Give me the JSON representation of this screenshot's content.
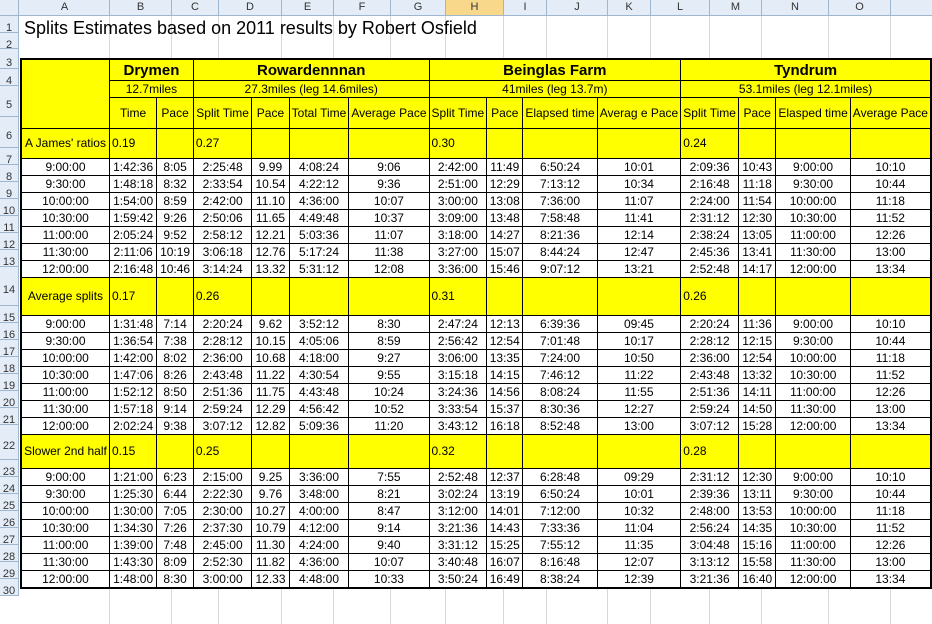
{
  "columns": [
    "A",
    "B",
    "C",
    "D",
    "E",
    "F",
    "G",
    "H",
    "I",
    "J",
    "K",
    "L",
    "M",
    "N",
    "O"
  ],
  "selected_column": "H",
  "rows": [
    "1",
    "2",
    "3",
    "4",
    "5",
    "6",
    "7",
    "8",
    "9",
    "10",
    "11",
    "12",
    "13",
    "14",
    "15",
    "16",
    "17",
    "18",
    "19",
    "20",
    "21",
    "22",
    "23",
    "24",
    "25",
    "26",
    "27",
    "28",
    "29",
    "30"
  ],
  "title": "Splits Estimates based on 2011 results by Robert Osfield",
  "sections": {
    "drymen": "Drymen",
    "rowardennan": "Rowardennnan",
    "beinglas": "Beinglas Farm",
    "tyndrum": "Tyndrum"
  },
  "distances": {
    "drymen": "12.7miles",
    "rowardennan": "27.3miles  (leg 14.6miles)",
    "beinglas": "41miles (leg 13.7m)",
    "tyndrum": "53.1miles (leg 12.1miles)"
  },
  "subheaders": [
    "Time",
    "Pace",
    "Split Time",
    "Pace",
    "Total Time",
    "Average Pace",
    "Split Time",
    "Pace",
    "Elapsed time",
    "Averag e Pace",
    "Split Time",
    "Pace",
    "Elasped time",
    "Average Pace"
  ],
  "blocks": [
    {
      "label": "A James' ratios",
      "ratios": {
        "drymen": "0.19",
        "rowardennan": "0.27",
        "beinglas": "0.30",
        "tyndrum": "0.24"
      },
      "rows": [
        [
          "9:00:00",
          "1:42:36",
          "8:05",
          "2:25:48",
          "9.99",
          "4:08:24",
          "9:06",
          "2:42:00",
          "11:49",
          "6:50:24",
          "10:01",
          "2:09:36",
          "10:43",
          "9:00:00",
          "10:10"
        ],
        [
          "9:30:00",
          "1:48:18",
          "8:32",
          "2:33:54",
          "10.54",
          "4:22:12",
          "9:36",
          "2:51:00",
          "12:29",
          "7:13:12",
          "10:34",
          "2:16:48",
          "11:18",
          "9:30:00",
          "10:44"
        ],
        [
          "10:00:00",
          "1:54:00",
          "8:59",
          "2:42:00",
          "11.10",
          "4:36:00",
          "10:07",
          "3:00:00",
          "13:08",
          "7:36:00",
          "11:07",
          "2:24:00",
          "11:54",
          "10:00:00",
          "11:18"
        ],
        [
          "10:30:00",
          "1:59:42",
          "9:26",
          "2:50:06",
          "11.65",
          "4:49:48",
          "10:37",
          "3:09:00",
          "13:48",
          "7:58:48",
          "11:41",
          "2:31:12",
          "12:30",
          "10:30:00",
          "11:52"
        ],
        [
          "11:00:00",
          "2:05:24",
          "9:52",
          "2:58:12",
          "12.21",
          "5:03:36",
          "11:07",
          "3:18:00",
          "14:27",
          "8:21:36",
          "12:14",
          "2:38:24",
          "13:05",
          "11:00:00",
          "12:26"
        ],
        [
          "11:30:00",
          "2:11:06",
          "10:19",
          "3:06:18",
          "12.76",
          "5:17:24",
          "11:38",
          "3:27:00",
          "15:07",
          "8:44:24",
          "12:47",
          "2:45:36",
          "13:41",
          "11:30:00",
          "13:00"
        ],
        [
          "12:00:00",
          "2:16:48",
          "10:46",
          "3:14:24",
          "13.32",
          "5:31:12",
          "12:08",
          "3:36:00",
          "15:46",
          "9:07:12",
          "13:21",
          "2:52:48",
          "14:17",
          "12:00:00",
          "13:34"
        ]
      ]
    },
    {
      "label": "Average splits",
      "ratios": {
        "drymen": "0.17",
        "rowardennan": "0.26",
        "beinglas": "0.31",
        "tyndrum": "0.26"
      },
      "rows": [
        [
          "9:00:00",
          "1:31:48",
          "7:14",
          "2:20:24",
          "9.62",
          "3:52:12",
          "8:30",
          "2:47:24",
          "12:13",
          "6:39:36",
          "09:45",
          "2:20:24",
          "11:36",
          "9:00:00",
          "10:10"
        ],
        [
          "9:30:00",
          "1:36:54",
          "7:38",
          "2:28:12",
          "10.15",
          "4:05:06",
          "8:59",
          "2:56:42",
          "12:54",
          "7:01:48",
          "10:17",
          "2:28:12",
          "12:15",
          "9:30:00",
          "10:44"
        ],
        [
          "10:00:00",
          "1:42:00",
          "8:02",
          "2:36:00",
          "10.68",
          "4:18:00",
          "9:27",
          "3:06:00",
          "13:35",
          "7:24:00",
          "10:50",
          "2:36:00",
          "12:54",
          "10:00:00",
          "11:18"
        ],
        [
          "10:30:00",
          "1:47:06",
          "8:26",
          "2:43:48",
          "11.22",
          "4:30:54",
          "9:55",
          "3:15:18",
          "14:15",
          "7:46:12",
          "11:22",
          "2:43:48",
          "13:32",
          "10:30:00",
          "11:52"
        ],
        [
          "11:00:00",
          "1:52:12",
          "8:50",
          "2:51:36",
          "11.75",
          "4:43:48",
          "10:24",
          "3:24:36",
          "14:56",
          "8:08:24",
          "11:55",
          "2:51:36",
          "14:11",
          "11:00:00",
          "12:26"
        ],
        [
          "11:30:00",
          "1:57:18",
          "9:14",
          "2:59:24",
          "12.29",
          "4:56:42",
          "10:52",
          "3:33:54",
          "15:37",
          "8:30:36",
          "12:27",
          "2:59:24",
          "14:50",
          "11:30:00",
          "13:00"
        ],
        [
          "12:00:00",
          "2:02:24",
          "9:38",
          "3:07:12",
          "12.82",
          "5:09:36",
          "11:20",
          "3:43:12",
          "16:18",
          "8:52:48",
          "13:00",
          "3:07:12",
          "15:28",
          "12:00:00",
          "13:34"
        ]
      ]
    },
    {
      "label": "Slower 2nd half",
      "ratios": {
        "drymen": "0.15",
        "rowardennan": "0.25",
        "beinglas": "0.32",
        "tyndrum": "0.28"
      },
      "rows": [
        [
          "9:00:00",
          "1:21:00",
          "6:23",
          "2:15:00",
          "9.25",
          "3:36:00",
          "7:55",
          "2:52:48",
          "12:37",
          "6:28:48",
          "09:29",
          "2:31:12",
          "12:30",
          "9:00:00",
          "10:10"
        ],
        [
          "9:30:00",
          "1:25:30",
          "6:44",
          "2:22:30",
          "9.76",
          "3:48:00",
          "8:21",
          "3:02:24",
          "13:19",
          "6:50:24",
          "10:01",
          "2:39:36",
          "13:11",
          "9:30:00",
          "10:44"
        ],
        [
          "10:00:00",
          "1:30:00",
          "7:05",
          "2:30:00",
          "10.27",
          "4:00:00",
          "8:47",
          "3:12:00",
          "14:01",
          "7:12:00",
          "10:32",
          "2:48:00",
          "13:53",
          "10:00:00",
          "11:18"
        ],
        [
          "10:30:00",
          "1:34:30",
          "7:26",
          "2:37:30",
          "10.79",
          "4:12:00",
          "9:14",
          "3:21:36",
          "14:43",
          "7:33:36",
          "11:04",
          "2:56:24",
          "14:35",
          "10:30:00",
          "11:52"
        ],
        [
          "11:00:00",
          "1:39:00",
          "7:48",
          "2:45:00",
          "11.30",
          "4:24:00",
          "9:40",
          "3:31:12",
          "15:25",
          "7:55:12",
          "11:35",
          "3:04:48",
          "15:16",
          "11:00:00",
          "12:26"
        ],
        [
          "11:30:00",
          "1:43:30",
          "8:09",
          "2:52:30",
          "11.82",
          "4:36:00",
          "10:07",
          "3:40:48",
          "16:07",
          "8:16:48",
          "12:07",
          "3:13:12",
          "15:58",
          "11:30:00",
          "13:00"
        ],
        [
          "12:00:00",
          "1:48:00",
          "8:30",
          "3:00:00",
          "12.33",
          "4:48:00",
          "10:33",
          "3:50:24",
          "16:49",
          "8:38:24",
          "12:39",
          "3:21:36",
          "16:40",
          "12:00:00",
          "13:34"
        ]
      ]
    }
  ]
}
